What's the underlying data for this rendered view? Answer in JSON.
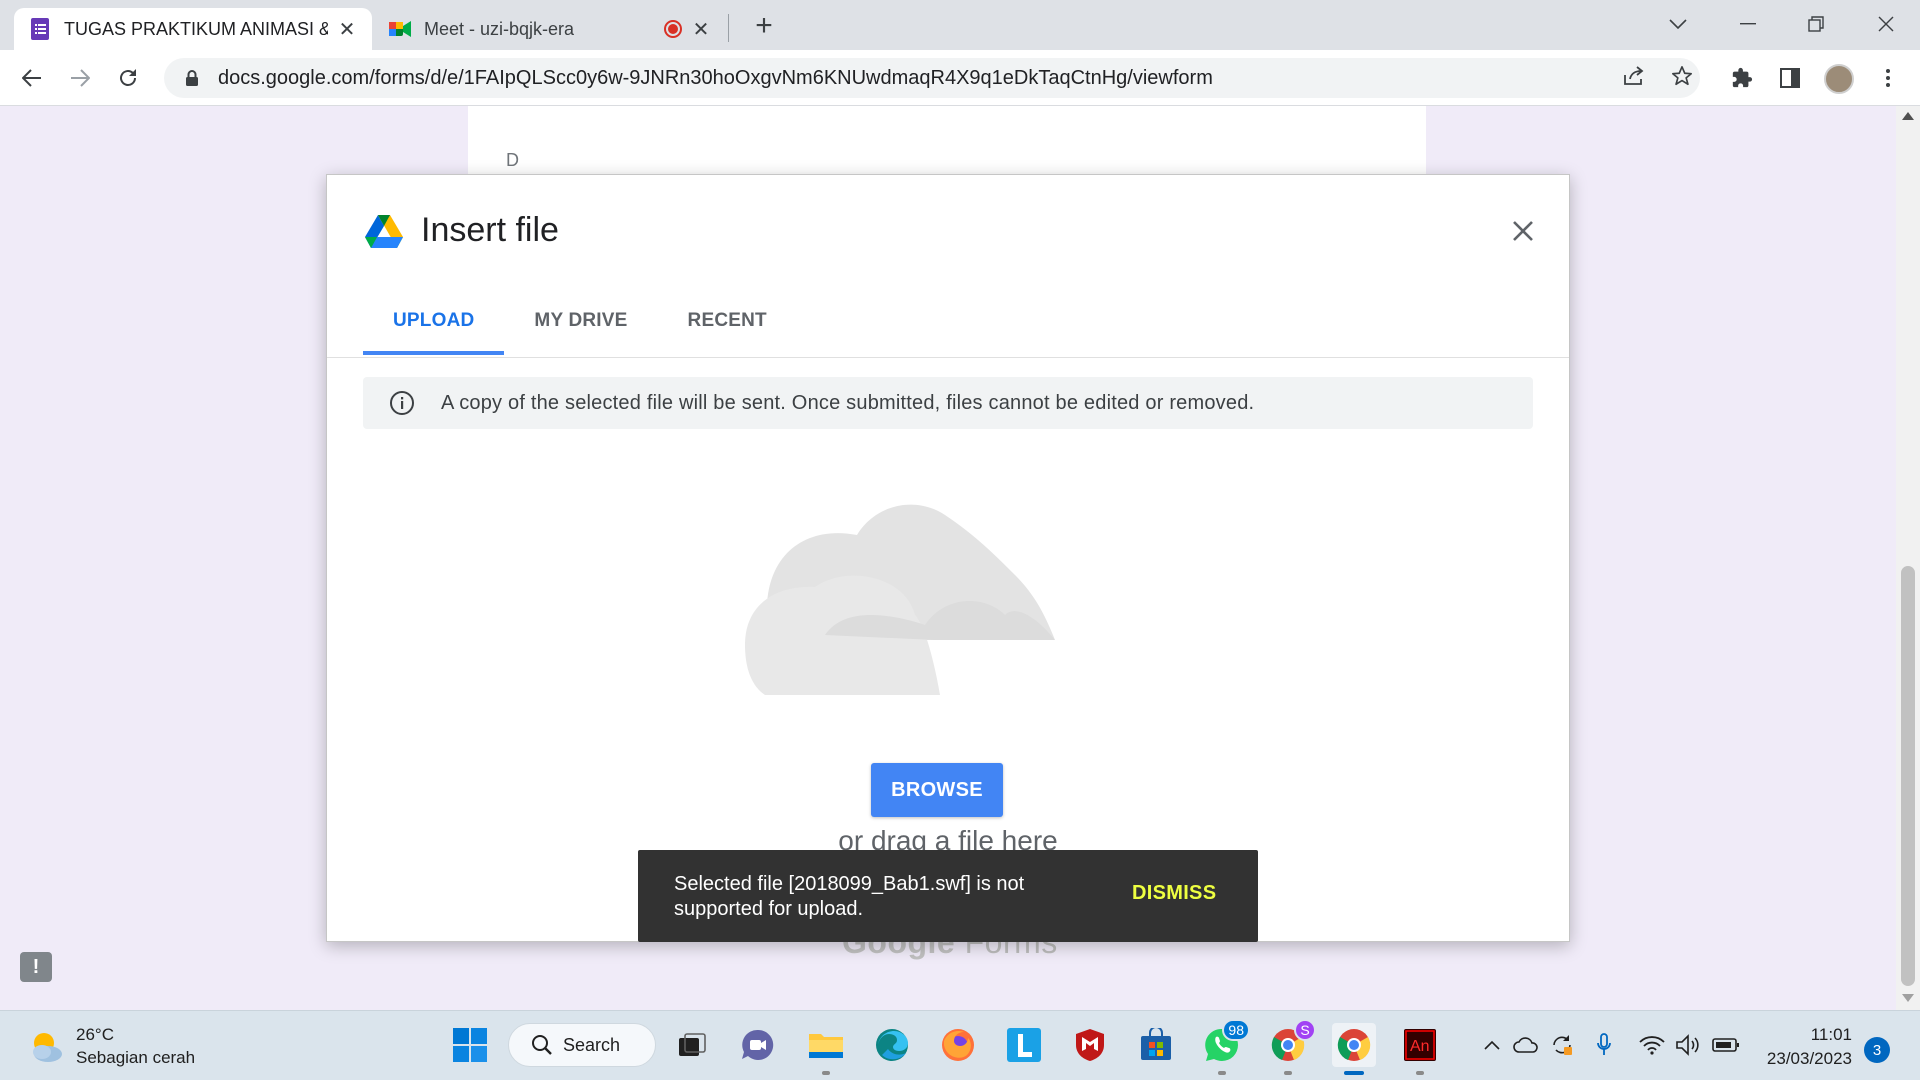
{
  "browser": {
    "tabs": [
      {
        "title": "TUGAS PRAKTIKUM ANIMASI & C",
        "active": true
      },
      {
        "title": "Meet - uzi-bqjk-era",
        "active": false
      }
    ],
    "url": "docs.google.com/forms/d/e/1FAIpQLScc0y6w-9JNRn30hoOxgvNm6KNUwdmaqR4X9q1eDkTaqCtnHg/viewform"
  },
  "page": {
    "option_letter": "D",
    "footer_brand": "Google",
    "footer_product": "Forms",
    "feedback_glyph": "!"
  },
  "dialog": {
    "title": "Insert file",
    "tabs": [
      "UPLOAD",
      "MY DRIVE",
      "RECENT"
    ],
    "active_tab": "UPLOAD",
    "info": "A copy of the selected file will be sent. Once submitted, files cannot be edited or removed.",
    "browse_label": "BROWSE",
    "drag_text": "or drag a file here"
  },
  "snackbar": {
    "message": "Selected file [2018099_Bab1.swf] is not supported for upload.",
    "action": "DISMISS",
    "action_color": "#eeff41"
  },
  "taskbar": {
    "weather_temp": "26°C",
    "weather_desc": "Sebagian cerah",
    "search_label": "Search",
    "whatsapp_badge": "98",
    "chrome_profile_badge": "S",
    "time": "11:01",
    "date": "23/03/2023",
    "notifications": "3"
  },
  "colors": {
    "accent": "#1a73e8",
    "browse_bg": "#4285f4",
    "page_bg": "#f0ebf8",
    "snackbar_bg": "#323232"
  }
}
